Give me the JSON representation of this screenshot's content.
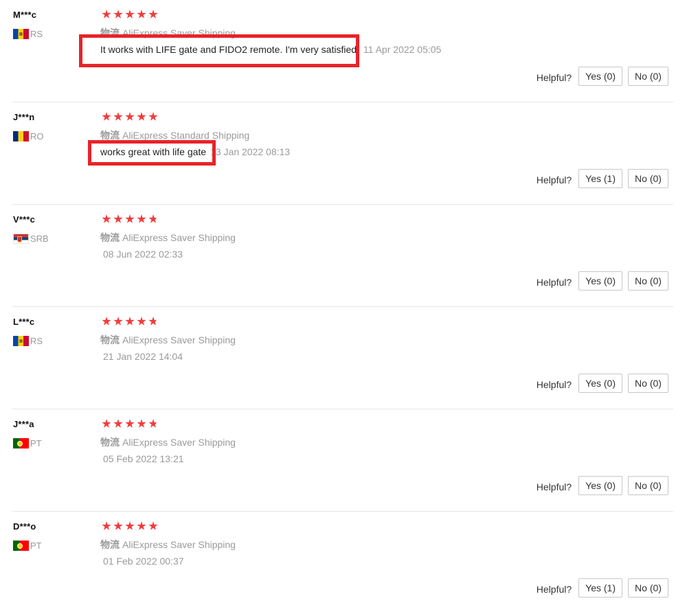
{
  "shipping_label": "物流",
  "helpful_label": "Helpful?",
  "colors": {
    "star": "#f23c3c",
    "highlight": "#e8232a",
    "muted_text": "#9a9a9a"
  },
  "reviews": [
    {
      "user": "M***c",
      "flag_icon": "moldova-flag-icon",
      "country": "RS",
      "rating": 5,
      "shipping": "AliExpress Saver Shipping",
      "text": "It works with LIFE gate and FIDO2 remote. I'm very satisfied.",
      "date": "11 Apr 2022 05:05",
      "yes_label": "Yes (0)",
      "no_label": "No (0)"
    },
    {
      "user": "J***n",
      "flag_icon": "romania-flag-icon",
      "country": "RO",
      "rating": 5,
      "shipping": "AliExpress Standard Shipping",
      "text": "works great with life gate",
      "date": "13 Jan 2022 08:13",
      "yes_label": "Yes (1)",
      "no_label": "No (0)"
    },
    {
      "user": "V***c",
      "flag_icon": "serbia-flag-icon",
      "country": "SRB",
      "rating": 4.8,
      "shipping": "AliExpress Saver Shipping",
      "text": "",
      "date": "08 Jun 2022 02:33",
      "yes_label": "Yes (0)",
      "no_label": "No (0)"
    },
    {
      "user": "L***c",
      "flag_icon": "moldova-flag-icon",
      "country": "RS",
      "rating": 4.8,
      "shipping": "AliExpress Saver Shipping",
      "text": "",
      "date": "21 Jan 2022 14:04",
      "yes_label": "Yes (0)",
      "no_label": "No (0)"
    },
    {
      "user": "J***a",
      "flag_icon": "portugal-flag-icon",
      "country": "PT",
      "rating": 4.8,
      "shipping": "AliExpress Saver Shipping",
      "text": "",
      "date": "05 Feb 2022 13:21",
      "yes_label": "Yes (0)",
      "no_label": "No (0)"
    },
    {
      "user": "D***o",
      "flag_icon": "portugal-flag-icon",
      "country": "PT",
      "rating": 5,
      "shipping": "AliExpress Saver Shipping",
      "text": "",
      "date": "01 Feb 2022 00:37",
      "yes_label": "Yes (1)",
      "no_label": "No (0)"
    }
  ]
}
